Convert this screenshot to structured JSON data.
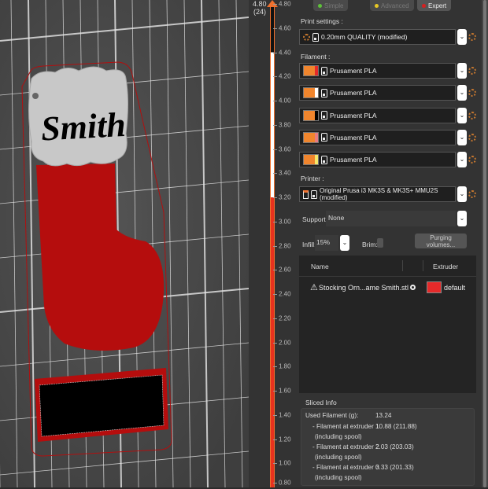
{
  "scene": {
    "name_text": "Smith",
    "colors": {
      "bed": "#4d4d4d",
      "grid": "#e8e8e8",
      "stocking": "#b50d0d",
      "cuff": "#c8c8c8",
      "plate": "#000000"
    }
  },
  "layer_slider": {
    "top_value": "4.80",
    "top_layer": "(24)",
    "ticks": [
      "4.80",
      "4.60",
      "4.40",
      "4.20",
      "4.00",
      "3.80",
      "3.60",
      "3.40",
      "3.20",
      "3.00",
      "2.80",
      "2.60",
      "2.40",
      "2.20",
      "2.00",
      "1.80",
      "1.60",
      "1.40",
      "1.20",
      "1.00",
      "0.80"
    ],
    "accent": "#f0702d"
  },
  "modes": [
    {
      "label": "Simple",
      "color": "#5ec23a",
      "active": false
    },
    {
      "label": "Advanced",
      "color": "#e8c825",
      "active": false
    },
    {
      "label": "Expert",
      "color": "#d62020",
      "active": true
    }
  ],
  "print_settings": {
    "label": "Print settings :",
    "value": "0.20mm QUALITY (modified)"
  },
  "filament": {
    "label": "Filament :",
    "items": [
      {
        "name": "Prusament PLA",
        "color": "#e52a2a"
      },
      {
        "name": "Prusament PLA",
        "color": "#ffffff"
      },
      {
        "name": "Prusament PLA",
        "color": "#000000"
      },
      {
        "name": "Prusament PLA",
        "color": "#e87a80"
      },
      {
        "name": "Prusament PLA",
        "color": "#f5e76a"
      }
    ]
  },
  "printer": {
    "label": "Printer :",
    "value": "Original Prusa i3 MK3S & MK3S+ MMU2S (modified)"
  },
  "supports": {
    "label": "Supports:",
    "value": "None"
  },
  "infill": {
    "label": "Infill:",
    "value": "15%"
  },
  "brim": {
    "label": "Brim:",
    "checked": false
  },
  "purging_button": "Purging volumes...",
  "object_list": {
    "columns": [
      "Name",
      "",
      "Extruder"
    ],
    "rows": [
      {
        "name": "Stocking Orn...ame Smith.stl",
        "extruder": "default",
        "extruder_color": "#e52a2a"
      }
    ]
  },
  "sliced_info": {
    "title": "Sliced Info",
    "rows": [
      {
        "label": "Used Filament (g):",
        "value": "13.24"
      },
      {
        "label": "- Filament at extruder 1",
        "sub": "(including spool)",
        "value": "10.88 (211.88)"
      },
      {
        "label": "- Filament at extruder 2",
        "sub": "(including spool)",
        "value": "2.03 (203.03)"
      },
      {
        "label": "- Filament at extruder 3",
        "sub": "(including spool)",
        "value": "0.33 (201.33)"
      }
    ]
  }
}
